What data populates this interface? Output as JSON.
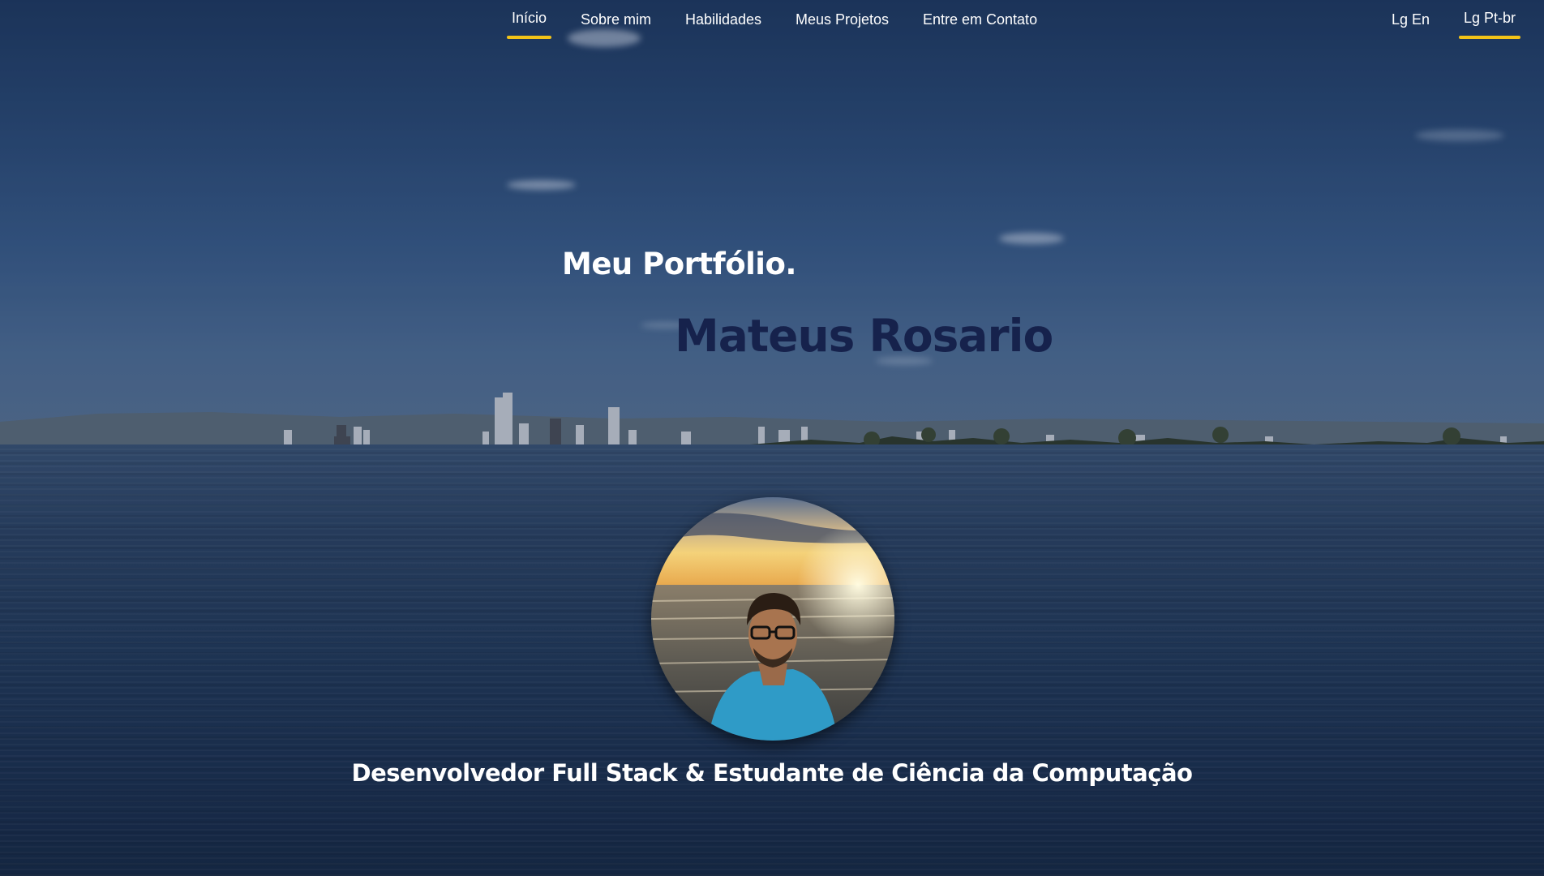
{
  "nav": {
    "items": [
      {
        "label": "Início",
        "active": true
      },
      {
        "label": "Sobre mim",
        "active": false
      },
      {
        "label": "Habilidades",
        "active": false
      },
      {
        "label": "Meus Projetos",
        "active": false
      },
      {
        "label": "Entre em Contato",
        "active": false
      }
    ],
    "languages": [
      {
        "label": "Lg En",
        "active": false
      },
      {
        "label": "Lg Pt-br",
        "active": true
      }
    ]
  },
  "hero": {
    "subtitle": "Meu Portfólio.",
    "name": "Mateus Rosario",
    "tagline": "Desenvolvedor Full Stack & Estudante de Ciência da Computação"
  },
  "colors": {
    "accent": "#f2c318",
    "name_text": "#16224c",
    "nav_text": "#ffffff",
    "sky": "#2b4b78",
    "water": "#223a5b"
  },
  "icons": {
    "avatar": "profile-photo"
  }
}
